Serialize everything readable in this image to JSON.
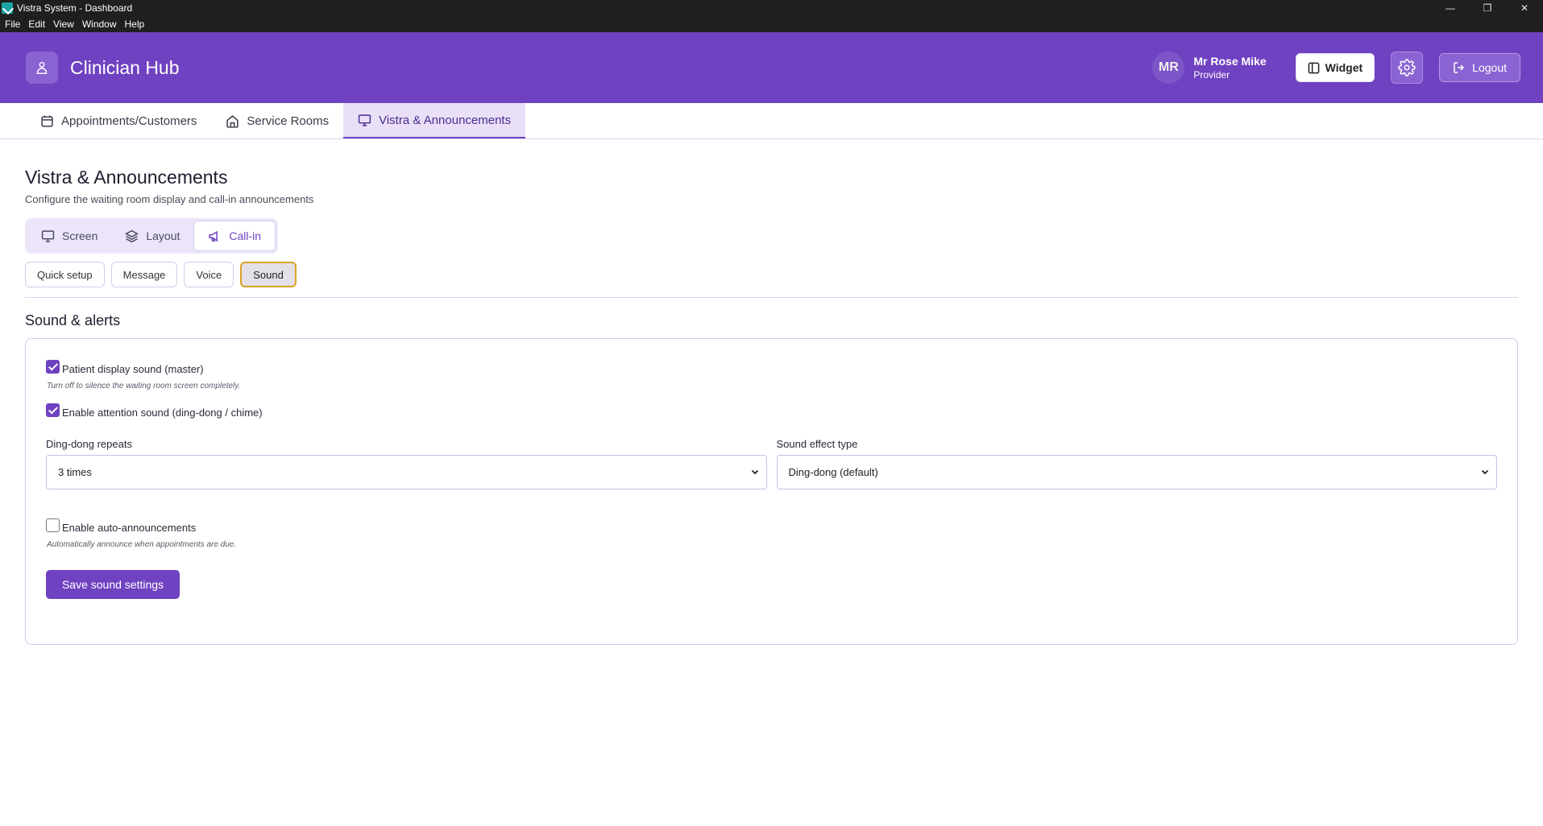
{
  "window": {
    "title": "Vistra System - Dashboard",
    "controls": {
      "minimize": "—",
      "restore": "❐",
      "close": "✕"
    }
  },
  "menu": [
    "File",
    "Edit",
    "View",
    "Window",
    "Help"
  ],
  "header": {
    "brand": "Clinician Hub",
    "logo_icon": "clinic-logo-icon",
    "user": {
      "initials": "MR",
      "name": "Mr Rose Mike",
      "role": "Provider"
    },
    "widget_label": "Widget",
    "logout_label": "Logout",
    "accent_color": "#6f42c1"
  },
  "main_tabs": [
    {
      "label": "Appointments/Customers",
      "icon": "calendar-icon",
      "active": false
    },
    {
      "label": "Service Rooms",
      "icon": "home-icon",
      "active": false
    },
    {
      "label": "Vistra & Announcements",
      "icon": "monitor-icon",
      "active": true
    }
  ],
  "page": {
    "title": "Vistra & Announcements",
    "subtitle": "Configure the waiting room display and call-in announcements"
  },
  "segments": [
    {
      "label": "Screen",
      "icon": "monitor-icon",
      "active": false
    },
    {
      "label": "Layout",
      "icon": "layers-icon",
      "active": false
    },
    {
      "label": "Call-in",
      "icon": "megaphone-icon",
      "active": true
    }
  ],
  "subtabs": [
    {
      "label": "Quick setup",
      "active": false
    },
    {
      "label": "Message",
      "active": false
    },
    {
      "label": "Voice",
      "active": false
    },
    {
      "label": "Sound",
      "active": true
    }
  ],
  "sound": {
    "section_title": "Sound & alerts",
    "master": {
      "label": "Patient display sound (master)",
      "checked": true,
      "hint": "Turn off to silence the waiting room screen completely."
    },
    "attention": {
      "label": "Enable attention sound (ding-dong / chime)",
      "checked": true
    },
    "repeats": {
      "label": "Ding-dong repeats",
      "value": "3 times"
    },
    "effect": {
      "label": "Sound effect type",
      "value": "Ding-dong (default)"
    },
    "auto": {
      "label": "Enable auto-announcements",
      "checked": false,
      "hint": "Automatically announce when appointments are due."
    },
    "save_label": "Save sound settings"
  }
}
